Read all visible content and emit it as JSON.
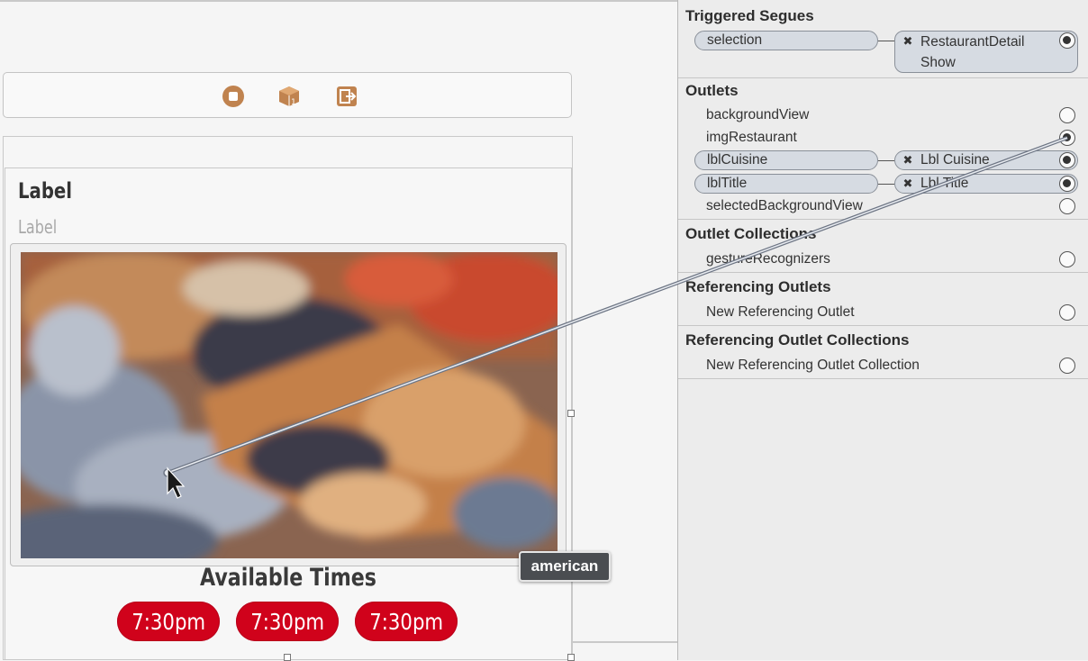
{
  "toolbar": {
    "icons": [
      "stop-icon",
      "cube-icon",
      "exit-icon"
    ],
    "accent": "#c0834f"
  },
  "cell": {
    "title_label": "Label",
    "cuisine_label": "Label",
    "available_times": "Available Times",
    "time_buttons": [
      "7:30pm",
      "7:30pm",
      "7:30pm"
    ],
    "button_color": "#d0021b"
  },
  "tooltip": {
    "text": "american"
  },
  "inspector": {
    "triggered_segues": {
      "title": "Triggered Segues",
      "rows": [
        {
          "source": "selection",
          "target_line1": "RestaurantDetail",
          "target_line2": "Show"
        }
      ]
    },
    "outlets": {
      "title": "Outlets",
      "rows": [
        {
          "name": "backgroundView",
          "connected": false
        },
        {
          "name": "imgRestaurant",
          "connected": false
        },
        {
          "name": "lblCuisine",
          "connected": true,
          "target": "Lbl Cuisine"
        },
        {
          "name": "lblTitle",
          "connected": true,
          "target": "Lbl Title"
        },
        {
          "name": "selectedBackgroundView",
          "connected": false
        }
      ]
    },
    "outlet_collections": {
      "title": "Outlet Collections",
      "rows": [
        {
          "name": "gestureRecognizers"
        }
      ]
    },
    "referencing_outlets": {
      "title": "Referencing Outlets",
      "rows": [
        {
          "name": "New Referencing Outlet"
        }
      ]
    },
    "referencing_outlet_collections": {
      "title": "Referencing Outlet Collections",
      "rows": [
        {
          "name": "New Referencing Outlet Collection"
        }
      ]
    }
  }
}
